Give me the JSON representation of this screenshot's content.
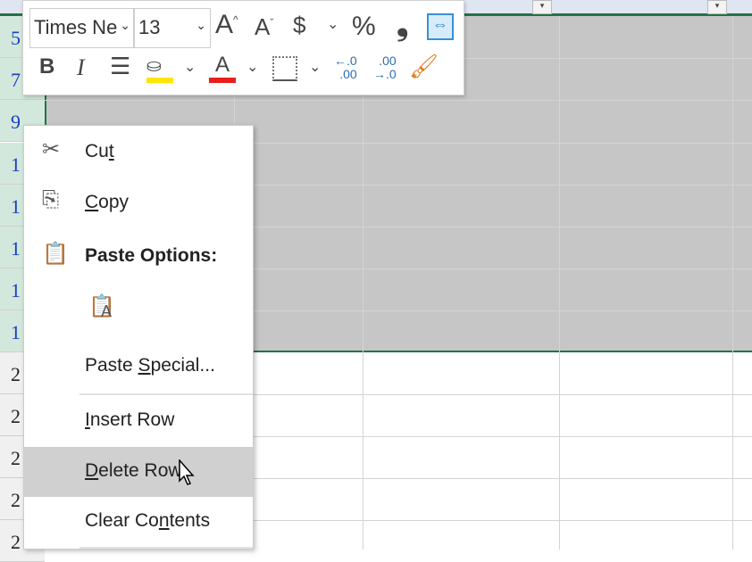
{
  "toolbar": {
    "font_name": "Times Ne",
    "font_size": "13",
    "increase_font": "A",
    "decrease_font": "A",
    "currency": "$",
    "percent": "%",
    "comma": "❟",
    "bold": "B",
    "italic": "I",
    "font_color_letter": "A",
    "increase_decimal": "←.0\n.00",
    "decrease_decimal": ".00\n→.0",
    "fill_color": "#ffe600",
    "font_color": "#e8201c"
  },
  "row_headers": [
    "5",
    "7",
    "9",
    "1",
    "1",
    "1",
    "1",
    "1",
    "2",
    "2",
    "2",
    "2",
    "2"
  ],
  "context_menu": {
    "cut": {
      "pre": "Cu",
      "u": "t",
      "post": ""
    },
    "copy": {
      "pre": "",
      "u": "C",
      "post": "opy"
    },
    "paste_options": "Paste Options:",
    "paste_special": {
      "pre": "Paste ",
      "u": "S",
      "post": "pecial..."
    },
    "insert_row": {
      "pre": "",
      "u": "I",
      "post": "nsert Row"
    },
    "delete_row": {
      "pre": "",
      "u": "D",
      "post": "elete Row"
    },
    "clear_contents": {
      "pre": "Clear Co",
      "u": "n",
      "post": "tents"
    }
  },
  "colors": {
    "selection": "#c6c6c6",
    "accent": "#217346"
  }
}
